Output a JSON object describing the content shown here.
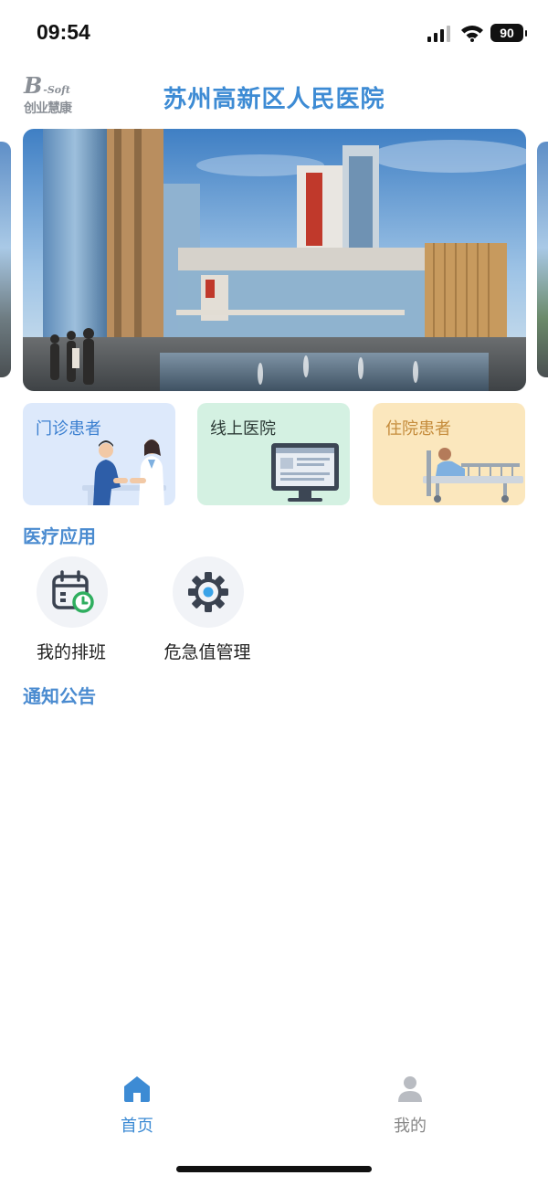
{
  "status_bar": {
    "time": "09:54",
    "battery": "90",
    "icons": [
      "signal-icon",
      "wifi-icon",
      "battery-icon"
    ]
  },
  "header": {
    "logo_mark": "B",
    "logo_mark_suffix": "-Soft",
    "logo_text": "创业慧康",
    "title": "苏州高新区人民医院"
  },
  "banner": {
    "image": "hospital-building-illustration"
  },
  "cards": [
    {
      "label": "门诊患者",
      "color": "#dde9fb",
      "icon": "doctor-patient-illustration"
    },
    {
      "label": "线上医院",
      "color": "#d4f1e2",
      "icon": "monitor-illustration"
    },
    {
      "label": "住院患者",
      "color": "#fbe7bd",
      "icon": "hospital-bed-illustration"
    }
  ],
  "medical_apps": {
    "title": "医疗应用",
    "items": [
      {
        "label": "我的排班",
        "icon": "calendar-clock-icon"
      },
      {
        "label": "危急值管理",
        "icon": "gear-icon"
      }
    ]
  },
  "notices": {
    "title": "通知公告"
  },
  "tab_bar": {
    "active_color": "#3d8bd4",
    "items": [
      {
        "label": "首页",
        "icon": "home-icon"
      },
      {
        "label": "我的",
        "icon": "user-icon"
      }
    ]
  }
}
